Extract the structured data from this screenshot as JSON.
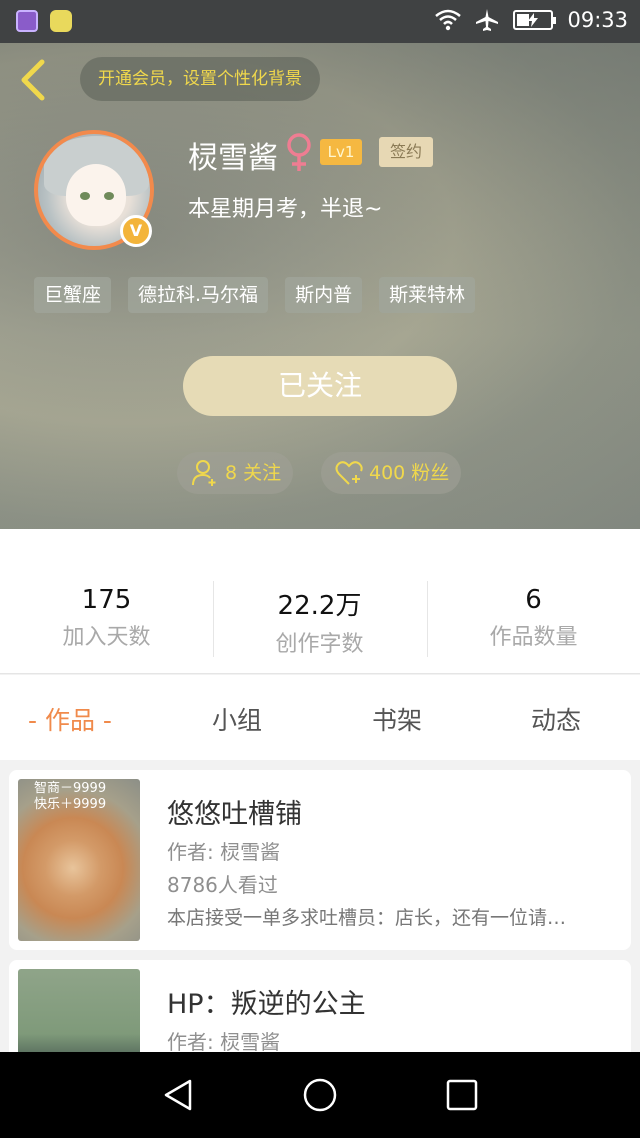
{
  "status_bar": {
    "time": "09:33",
    "icons": [
      "gallery-app-icon",
      "chat-app-icon",
      "wifi-icon",
      "airplane-icon",
      "battery-charging-icon"
    ]
  },
  "header": {
    "vip_prompt": "开通会员，设置个性化背景",
    "username": "棂雪酱",
    "gender": "female",
    "level": "Lv1",
    "sign_badge": "签约",
    "motto": "本星期月考，半退~",
    "verified_badge": "V",
    "tags": [
      "巨蟹座",
      "德拉科.马尔福",
      "斯内普",
      "斯莱特林"
    ],
    "follow_button": "已关注",
    "following_label": "8 关注",
    "followers_label": "400 粉丝",
    "colors": {
      "accent_yellow": "#f0d84c",
      "follow_button": "#e6dbb6",
      "avatar_ring": "#f28a4c"
    }
  },
  "stats": [
    {
      "value": "175",
      "label": "加入天数"
    },
    {
      "value": "22.2万",
      "label": "创作字数"
    },
    {
      "value": "6",
      "label": "作品数量"
    }
  ],
  "tabs": [
    {
      "label": "- 作品 -",
      "active": true
    },
    {
      "label": "小组",
      "active": false
    },
    {
      "label": "书架",
      "active": false
    },
    {
      "label": "动态",
      "active": false
    }
  ],
  "works": [
    {
      "title": "悠悠吐槽铺",
      "author": "作者: 棂雪酱",
      "views": "8786人看过",
      "description": "本店接受一单多求吐槽员：店长，还有一位请…",
      "cover_caption": [
        "智商－9999",
        "快乐＋9999"
      ]
    },
    {
      "title": "HP：叛逆的公主",
      "author": "作者: 棂雪酱",
      "views": "",
      "description": "",
      "cover_caption": []
    }
  ],
  "nav": {
    "icons": [
      "back-triangle-icon",
      "home-circle-icon",
      "recents-square-icon"
    ]
  },
  "theme": {
    "tab_active": "#f08a4b"
  }
}
